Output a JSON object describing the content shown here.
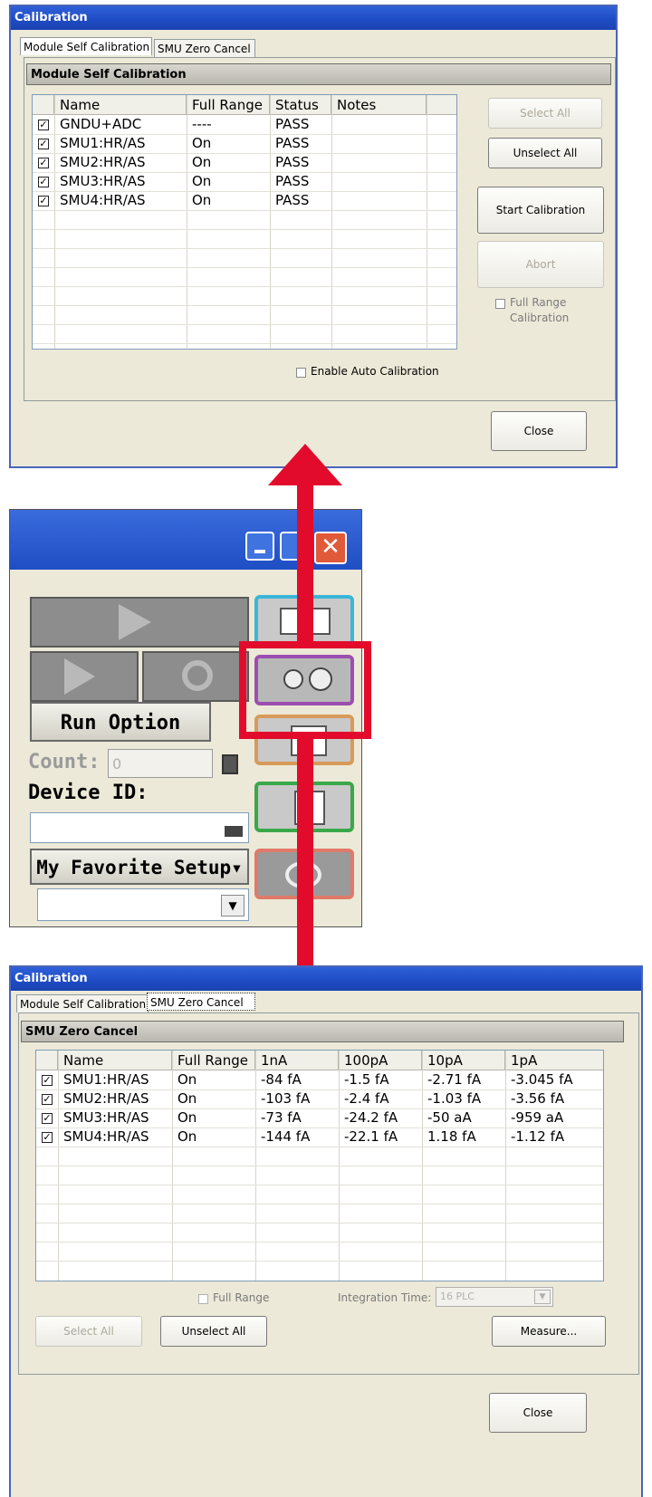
{
  "top_window": {
    "title": "Calibration",
    "tabs": [
      "Module Self Calibration",
      "SMU Zero Cancel"
    ],
    "group_title": "Module Self Calibration",
    "columns": [
      "Name",
      "Full Range",
      "Status",
      "Notes"
    ],
    "rows": [
      {
        "name": "GNDU+ADC",
        "full_range": "----",
        "status": "PASS"
      },
      {
        "name": "SMU1:HR/AS",
        "full_range": "On",
        "status": "PASS"
      },
      {
        "name": "SMU2:HR/AS",
        "full_range": "On",
        "status": "PASS"
      },
      {
        "name": "SMU3:HR/AS",
        "full_range": "On",
        "status": "PASS"
      },
      {
        "name": "SMU4:HR/AS",
        "full_range": "On",
        "status": "PASS"
      }
    ],
    "buttons": {
      "select_all": "Select All",
      "unselect_all": "Unselect All",
      "start_calibration": "Start Calibration",
      "abort": "Abort",
      "close": "Close"
    },
    "full_range_calibration": "Full Range\nCalibration",
    "full_range_line1": "Full Range",
    "full_range_line2": "Calibration",
    "enable_auto_calibration": "Enable Auto Calibration"
  },
  "middle_panel": {
    "run_option": "Run Option",
    "count_label": "Count:",
    "count_value": "0",
    "device_id_label": "Device ID:",
    "favorite_setup": "My Favorite Setup"
  },
  "bottom_window": {
    "title": "Calibration",
    "tabs": [
      "Module Self Calibration",
      "SMU Zero Cancel"
    ],
    "group_title": "SMU Zero Cancel",
    "columns": [
      "Name",
      "Full Range",
      "1nA",
      "100pA",
      "10pA",
      "1pA"
    ],
    "rows": [
      {
        "name": "SMU1:HR/AS",
        "full_range": "On",
        "c1nA": "-84 fA",
        "c100pA": "-1.5 fA",
        "c10pA": "-2.71 fA",
        "c1pA": "-3.045 fA"
      },
      {
        "name": "SMU2:HR/AS",
        "full_range": "On",
        "c1nA": "-103 fA",
        "c100pA": "-2.4 fA",
        "c10pA": "-1.03 fA",
        "c1pA": "-3.56 fA"
      },
      {
        "name": "SMU3:HR/AS",
        "full_range": "On",
        "c1nA": "-73 fA",
        "c100pA": "-24.2 fA",
        "c10pA": "-50 aA",
        "c1pA": "-959 aA"
      },
      {
        "name": "SMU4:HR/AS",
        "full_range": "On",
        "c1nA": "-144 fA",
        "c100pA": "-22.1 fA",
        "c10pA": "1.18 fA",
        "c1pA": "-1.12 fA"
      }
    ],
    "full_range_label": "Full Range",
    "integration_time_label": "Integration Time:",
    "integration_time_value": "16 PLC",
    "buttons": {
      "select_all": "Select All",
      "unselect_all": "Unselect All",
      "measure": "Measure...",
      "close": "Close"
    }
  },
  "colors": {
    "highlight_red": "#e30b2b",
    "title_blue": "#1e4bc4",
    "side_cyan": "#3ab6d8",
    "side_purple": "#9b4fb0",
    "side_orange": "#d89a5a",
    "side_green": "#3aa84a",
    "side_salmon": "#e07a6a"
  },
  "icons": [
    "checkbox-checked-icon",
    "play-icon",
    "play-plus-icon",
    "refresh-icon",
    "calculator-icon",
    "keyboard-icon",
    "dropdown-arrow-icon",
    "minimize-icon",
    "maximize-icon",
    "close-x-icon",
    "graph-icon",
    "tools-icon",
    "document-icon",
    "calc-panel-icon",
    "speaker-icon"
  ]
}
